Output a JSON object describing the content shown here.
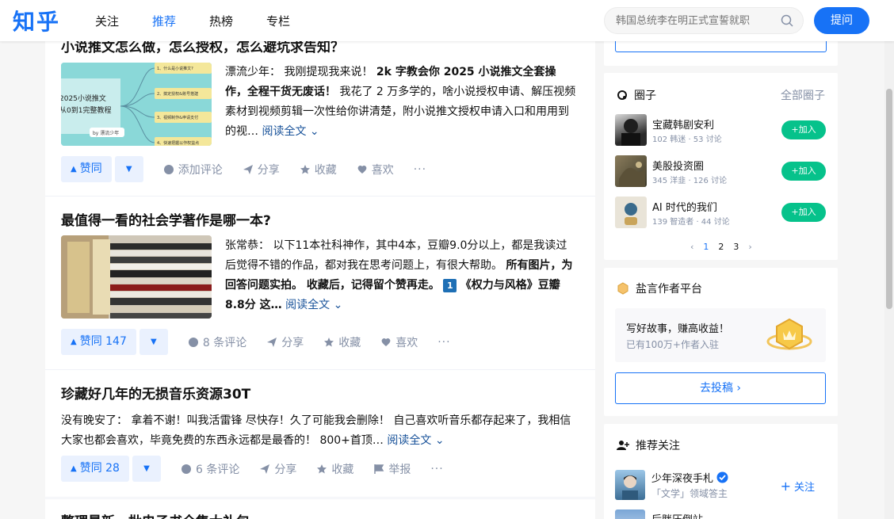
{
  "header": {
    "logo": "知乎",
    "nav": [
      "关注",
      "推荐",
      "热榜",
      "专栏"
    ],
    "search_placeholder": "韩国总统李在明正式宣誓就职",
    "ask_label": "提问"
  },
  "feed": [
    {
      "title": "小说推文怎么做，怎么授权，怎么避坑求告知？",
      "thumb_text": [
        "2025小说推文",
        "从0到1完整教程",
        "by 漂流少年",
        "1、什么是小说推文?",
        "2、搞定授权&账号搭建",
        "3、视频制作&申请支付",
        "4、快速把握以作权益点"
      ],
      "author": "漂流少年：",
      "excerpt_plain": " 我刚提现我来说！",
      "excerpt_bold": "2k 字教会你 2025 小说推文全套操作，全程干货无废话！",
      "excerpt_rest": "我花了 2 万多学的，啥小说授权申请、解压视频素材到视频剪辑一次性给你讲清楚，附小说推文授权申请入口和用用到的视…",
      "read_more": "阅读全文",
      "vote": "赞同",
      "comment": "添加评论",
      "share": "分享",
      "collect": "收藏",
      "like": "喜欢"
    },
    {
      "title": "最值得一看的社会学著作是哪一本?",
      "author": "张常恭：",
      "excerpt_plain": " 以下11本社科神作，其中4本，豆瓣9.0分以上，都是我读过后觉得不错的作品，都对我在思考问题上，有很大帮助。",
      "excerpt_bold": "所有图片，为回答问题实拍。 收藏后，记得留个赞再走。",
      "badge": "1",
      "excerpt_bold2": "《权力与风格》豆瓣8.8分 这…",
      "read_more": "阅读全文",
      "vote": "赞同 147",
      "comment": "8 条评论",
      "share": "分享",
      "collect": "收藏",
      "like": "喜欢"
    },
    {
      "title": "珍藏好几年的无损音乐资源30T",
      "excerpt_rest": "没有晚安了： 拿着不谢！叫我活雷锋 尽快存！久了可能我会删除！ 自己喜欢听音乐都存起来了，我相信大家也都会喜欢，毕竟免费的东西永远都是最香的！ 800+首顶…",
      "read_more": "阅读全文",
      "vote": "赞同 28",
      "comment": "6 条评论",
      "share": "分享",
      "collect": "收藏",
      "report": "举报"
    },
    {
      "title": "整理最新一批电子书全集大礼包"
    }
  ],
  "sidebar": {
    "top_button": "",
    "circles": {
      "title": "圈子",
      "all_link": "全部圈子",
      "join_label": "+加入",
      "items": [
        {
          "name": "宝藏韩剧安利",
          "meta": "102 韩迷 · 53 讨论"
        },
        {
          "name": "美股投资圈",
          "meta": "345 洋韭 · 126 讨论"
        },
        {
          "name": "AI 时代的我们",
          "meta": "139 智造者 · 44 讨论"
        }
      ],
      "pages": [
        "‹",
        "1",
        "2",
        "3",
        "›"
      ]
    },
    "yanyan": {
      "title": "盐言作者平台",
      "headline": "写好故事，赚高收益！",
      "sub": "已有100万+作者入驻",
      "button": "去投稿 ›"
    },
    "recommend": {
      "title": "推荐关注",
      "items": [
        {
          "name": "少年深夜手札",
          "desc": "「文学」领域答主",
          "follow": "关注"
        },
        {
          "name": "后胖压倒站",
          "desc": "",
          "follow": ""
        }
      ]
    }
  },
  "colors": {
    "brand": "#1772f6",
    "green": "#06c28b",
    "meta_gray": "#8590a6"
  }
}
